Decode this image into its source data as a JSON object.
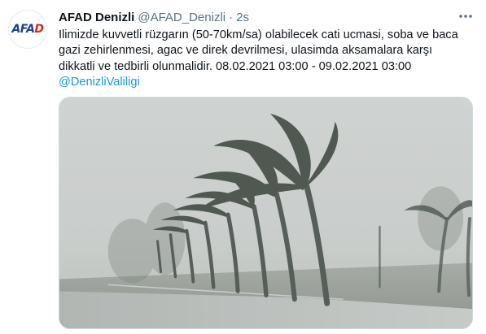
{
  "tweet": {
    "avatar": {
      "logo_main": "AFA",
      "logo_accent": "D"
    },
    "author_name": "AFAD Denizli",
    "author_handle": "@AFAD_Denizli",
    "separator": "·",
    "timestamp": "2s",
    "more_icon": "more-dots-icon",
    "text_lines": [
      "Ilimizde kuvvetli rüzgarın (50-70km/sa) olabilecek cati ucmasi, soba ve baca",
      "gazi zehirlenmesi, agac ve direk devrilmesi, ulasimda aksamalara karşı",
      "dikkatli ve tedbirli olunmalidir. 08.02.2021 03:00 - 09.02.2021 03:00"
    ],
    "mention": "@DenizliValiligi",
    "media": {
      "type": "photo",
      "subject": "palm-trees-in-storm"
    }
  }
}
